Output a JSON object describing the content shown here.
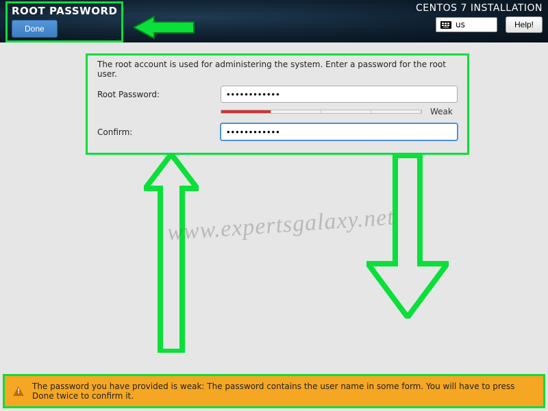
{
  "header": {
    "title": "ROOT PASSWORD",
    "done_label": "Done",
    "install_title": "CENTOS 7 INSTALLATION",
    "keyboard_layout": "us",
    "help_label": "Help!"
  },
  "form": {
    "description": "The root account is used for administering the system.  Enter a password for the root user.",
    "password_label": "Root Password:",
    "password_value": "••••••••••••",
    "confirm_label": "Confirm:",
    "confirm_value": "••••••••••••",
    "strength_label": "Weak"
  },
  "warning": {
    "text": "The password you have provided is weak: The password contains the user name in some form. You will have to press Done twice to confirm it."
  },
  "watermark": "www.expertsgalaxy.net",
  "annotation_color": "#0bdf3a"
}
